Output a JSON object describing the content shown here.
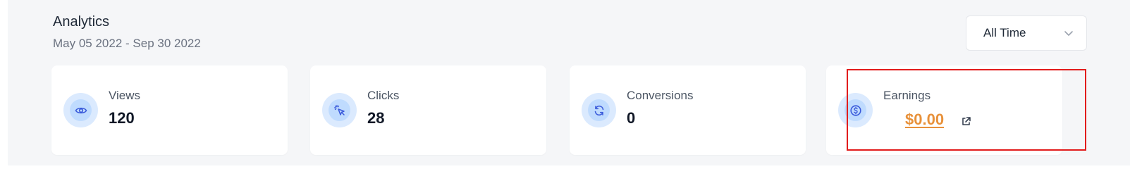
{
  "header": {
    "title": "Analytics",
    "date_range": "May 05 2022 - Sep 30 2022"
  },
  "period_select": {
    "selected": "All Time",
    "icon": "chevron-down-icon"
  },
  "stats": [
    {
      "label": "Views",
      "value": "120",
      "icon": "eye-icon"
    },
    {
      "label": "Clicks",
      "value": "28",
      "icon": "cursor-click-icon"
    },
    {
      "label": "Conversions",
      "value": "0",
      "icon": "refresh-icon"
    },
    {
      "label": "Earnings",
      "value": "$0.00",
      "icon": "dollar-icon",
      "link_icon": "external-link-icon"
    }
  ],
  "colors": {
    "accent": "#3b5bdb",
    "earnings": "#e8913a",
    "icon_bg": "#dbeafe",
    "highlight": "#e21c1c"
  }
}
